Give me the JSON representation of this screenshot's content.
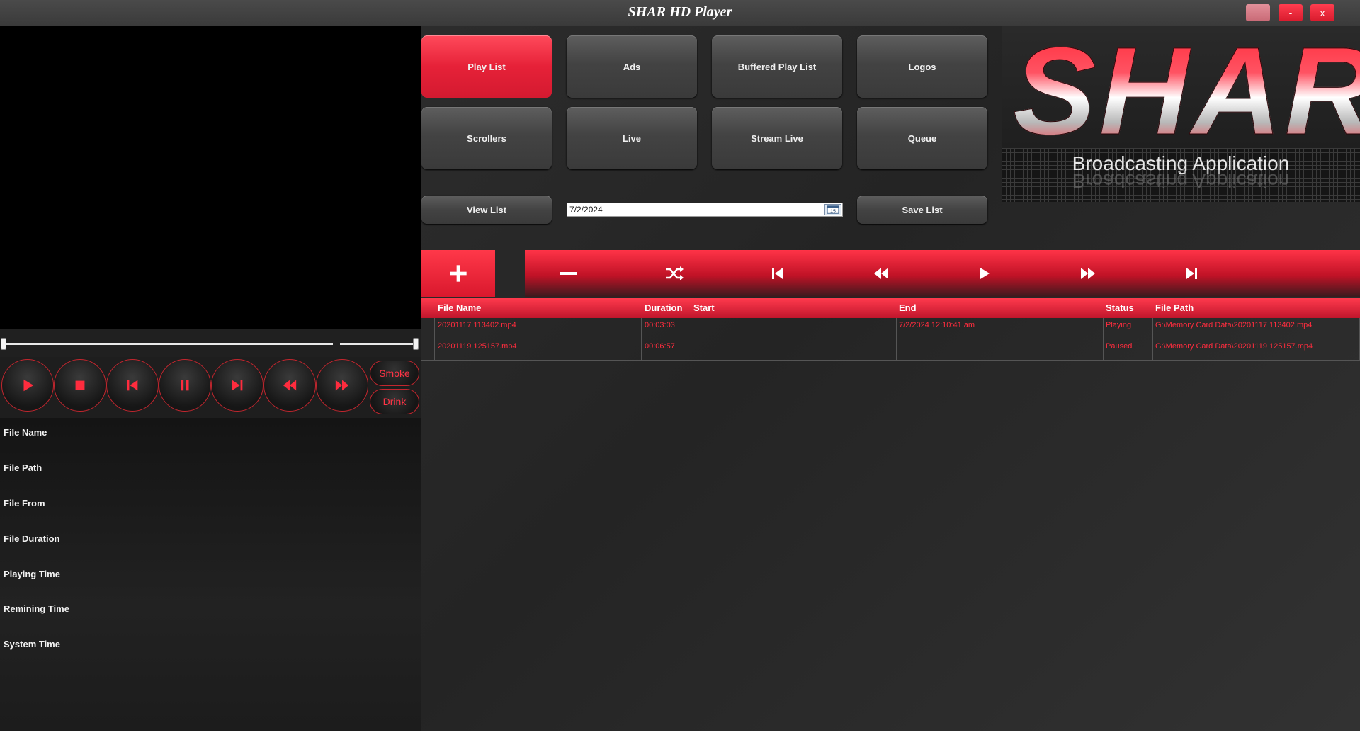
{
  "window": {
    "title": "SHAR HD Player",
    "minimize_label": "-",
    "close_label": "x"
  },
  "transport": {
    "buttons": [
      "play",
      "stop",
      "previous",
      "pause",
      "next",
      "rewind",
      "fast-forward"
    ],
    "smoke_label": "Smoke",
    "drink_label": "Drink",
    "accent_color": "#ff2c3e"
  },
  "info": {
    "labels": [
      "File Name",
      "File Path",
      "File From",
      "File Duration",
      "Playing Time",
      "Remining Time",
      "System Time"
    ]
  },
  "nav": {
    "play_list": "Play List",
    "ads": "Ads",
    "buffered_play_list": "Buffered Play List",
    "logos": "Logos",
    "scrollers": "Scrollers",
    "live": "Live",
    "stream_live": "Stream Live",
    "queue": "Queue",
    "view_list": "View List",
    "save_list": "Save List",
    "active": "Play List"
  },
  "date": {
    "value": "7/2/2024",
    "picker_icon": "calendar-icon"
  },
  "logo": {
    "wordmark": "SHAR",
    "subtitle": "Broadcasting Application"
  },
  "toolbar": {
    "icons": [
      "plus-icon",
      "minus-icon",
      "shuffle-icon",
      "skip-start-icon",
      "rewind-icon",
      "play-icon",
      "fast-forward-icon",
      "skip-end-icon"
    ],
    "more_label": "..."
  },
  "grid": {
    "columns": [
      "File Name",
      "Duration",
      "Start",
      "End",
      "Status",
      "File Path"
    ],
    "rows": [
      {
        "file_name": "20201117 113402.mp4",
        "duration": "00:03:03",
        "start": "",
        "end": "7/2/2024 12:10:41 am",
        "status": "Playing",
        "file_path": "G:\\Memory Card Data\\20201117 113402.mp4"
      },
      {
        "file_name": "20201119 125157.mp4",
        "duration": "00:06:57",
        "start": "",
        "end": "",
        "status": "Paused",
        "file_path": "G:\\Memory Card Data\\20201119 125157.mp4"
      }
    ]
  }
}
